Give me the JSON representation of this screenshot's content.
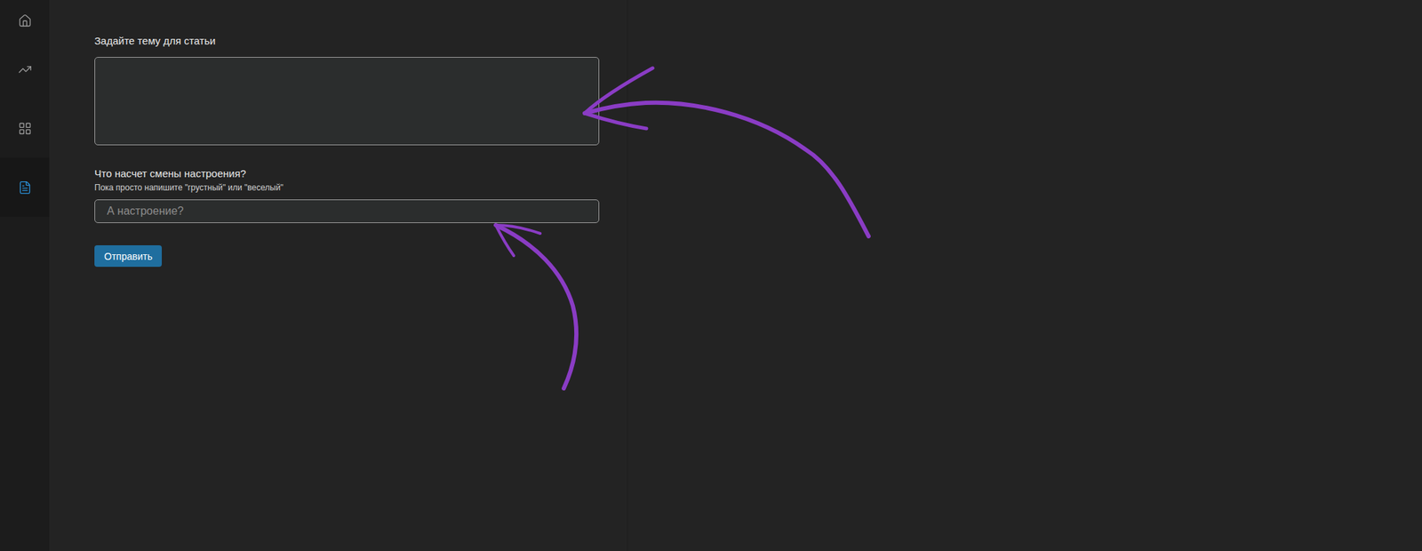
{
  "sidebar": {
    "items": [
      {
        "selected": false
      },
      {
        "selected": false
      },
      {
        "selected": false
      },
      {
        "selected": true
      }
    ]
  },
  "form": {
    "topic": {
      "label": "Задайте тему для статьи",
      "value": ""
    },
    "mood": {
      "label": "Что насчет смены настроения?",
      "hint": "Пока просто напишите \"грустный\" или \"веселый\"",
      "placeholder": "А настроение?",
      "value": ""
    },
    "submit": {
      "label": "Отправить"
    }
  }
}
